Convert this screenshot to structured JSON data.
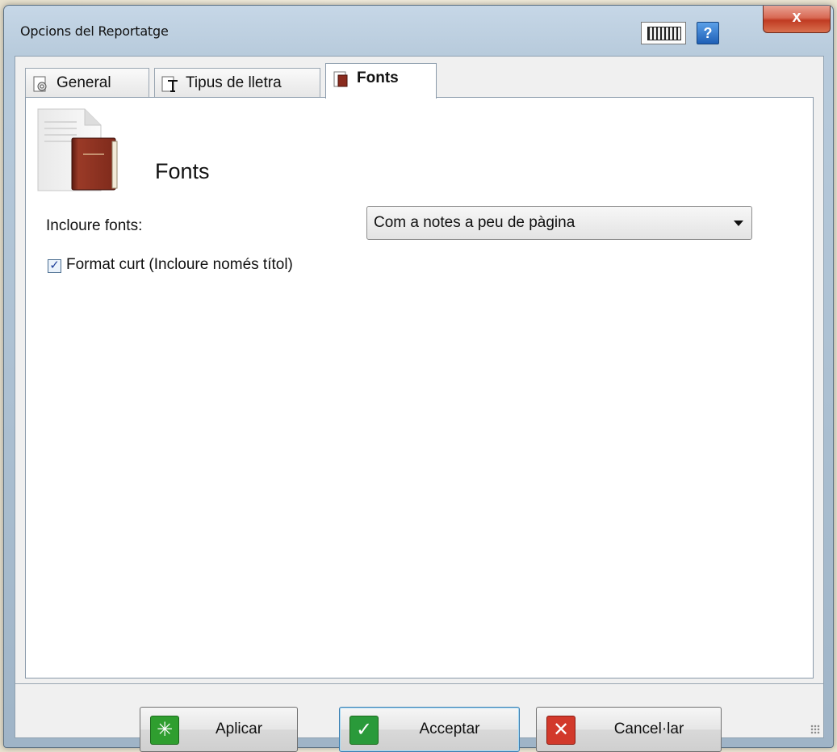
{
  "window": {
    "title": "Opcions del Reportatge",
    "help_label": "?",
    "close_label": "x"
  },
  "tabs": [
    {
      "label": "General",
      "icon": "gear-document-icon"
    },
    {
      "label": "Tipus de lletra",
      "icon": "text-cursor-icon"
    },
    {
      "label": "Fonts",
      "icon": "book-document-icon",
      "active": true
    }
  ],
  "page": {
    "title": "Fonts",
    "include_label": "Incloure fonts:",
    "include_value": "Com a notes a peu de pàgina",
    "short_format_label": "Format curt (Incloure només títol)",
    "short_format_checked": true
  },
  "buttons": {
    "apply": "Aplicar",
    "accept": "Acceptar",
    "cancel": "Cancel·lar"
  },
  "colors": {
    "apply_icon": "#2f9e2f",
    "accept_icon": "#2a9a3a",
    "cancel_icon": "#d2392b"
  }
}
